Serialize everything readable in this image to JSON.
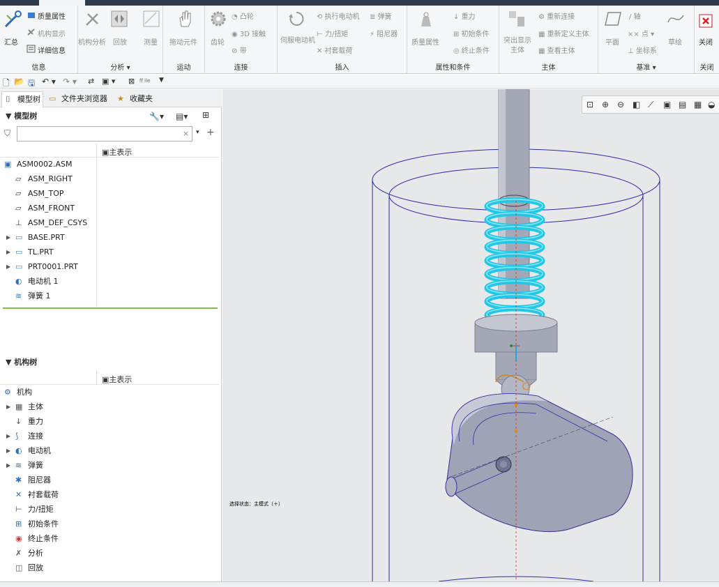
{
  "ribbon": {
    "groups": {
      "info": "信息",
      "analysis": "分析",
      "motion": "运动",
      "connect": "连接",
      "insert": "插入",
      "props": "属性和条件",
      "body": "主体",
      "datum": "基准",
      "close": "关闭"
    },
    "info": {
      "summary": "汇总",
      "mass_props": "质量属性",
      "mech_display": "机构显示",
      "details": "详细信息"
    },
    "analysis": {
      "mech_analysis": "机构分析",
      "playback": "回放",
      "measure": "测量"
    },
    "motion": {
      "drag": "拖动元件"
    },
    "connect": {
      "gear": "齿轮",
      "cam": "凸轮",
      "contact3d": "3D 接触",
      "belt": "带"
    },
    "insert": {
      "servo": "伺服电动机",
      "run_motor": "执行电动机",
      "force": "力/扭矩",
      "bushing": "衬套载荷",
      "spring": "弹簧",
      "damper": "阻尼器"
    },
    "props": {
      "mass": "质量属性",
      "gravity": "重力",
      "init": "初始条件",
      "term": "终止条件"
    },
    "body": {
      "highlight": "突出显示主体",
      "reconnect": "重新连接",
      "redefine": "重新定义主体",
      "view": "查看主体"
    },
    "datum": {
      "plane": "平面",
      "axis": "轴",
      "point": "点",
      "csys": "坐标系",
      "sketch": "草绘"
    },
    "close": {
      "close": "关闭"
    }
  },
  "tabs": {
    "model_tree": "模型树",
    "folder_browser": "文件夹浏览器",
    "favorites": "收藏夹"
  },
  "model_tree": {
    "title": "模型树",
    "column": "主表示",
    "search_placeholder": "",
    "items": [
      {
        "label": "ASM0002.ASM",
        "icon": "assembly-icon"
      },
      {
        "label": "ASM_RIGHT",
        "icon": "datum-plane-icon"
      },
      {
        "label": "ASM_TOP",
        "icon": "datum-plane-icon"
      },
      {
        "label": "ASM_FRONT",
        "icon": "datum-plane-icon"
      },
      {
        "label": "ASM_DEF_CSYS",
        "icon": "csys-icon"
      },
      {
        "label": "BASE.PRT",
        "icon": "part-icon"
      },
      {
        "label": "TL.PRT",
        "icon": "part-icon"
      },
      {
        "label": "PRT0001.PRT",
        "icon": "part-icon"
      },
      {
        "label": "电动机 1",
        "icon": "motor-icon"
      },
      {
        "label": "弹簧 1",
        "icon": "spring-icon"
      }
    ]
  },
  "mech_tree": {
    "title": "机构树",
    "column": "主表示",
    "items": [
      {
        "label": "机构",
        "icon": "mechanism-icon"
      },
      {
        "label": "主体",
        "icon": "body-icon"
      },
      {
        "label": "重力",
        "icon": "gravity-icon"
      },
      {
        "label": "连接",
        "icon": "connection-icon"
      },
      {
        "label": "电动机",
        "icon": "motor-icon"
      },
      {
        "label": "弹簧",
        "icon": "spring-icon"
      },
      {
        "label": "阻尼器",
        "icon": "damper-icon"
      },
      {
        "label": "衬套载荷",
        "icon": "bushing-icon"
      },
      {
        "label": "力/扭矩",
        "icon": "force-icon"
      },
      {
        "label": "初始条件",
        "icon": "init-icon"
      },
      {
        "label": "终止条件",
        "icon": "terminate-icon"
      },
      {
        "label": "分析",
        "icon": "analysis-icon"
      },
      {
        "label": "回放",
        "icon": "playback-icon"
      }
    ]
  },
  "viewport": {
    "mode_text": "选择状态：主模式（＋）"
  },
  "colors": {
    "spring": "#22c7e6",
    "cam": "#a9adbd",
    "accent_green": "#79c043",
    "wire": "#2a2aaa"
  }
}
